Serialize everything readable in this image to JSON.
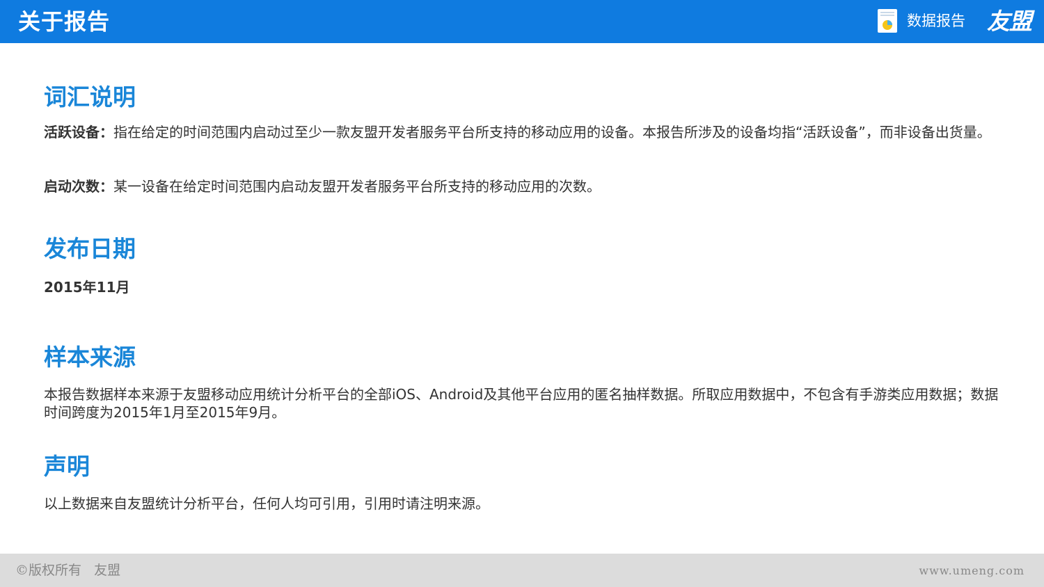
{
  "header": {
    "title": "关于报告",
    "report_label": "数据报告",
    "logo": "友盟",
    "icon": "report-document-icon",
    "bg_color": "#0f7be0"
  },
  "sections": {
    "glossary": {
      "title": "词汇说明",
      "items": [
        {
          "term": "活跃设备：",
          "text": "指在给定的时间范围内启动过至少一款友盟开发者服务平台所支持的移动应用的设备。本报告所涉及的设备均指“活跃设备”，而非设备出货量。"
        },
        {
          "term": "启动次数：",
          "text": "某一设备在给定时间范围内启动友盟开发者服务平台所支持的移动应用的次数。"
        }
      ]
    },
    "release": {
      "title": "发布日期",
      "date": "2015年11月"
    },
    "sample": {
      "title": "样本来源",
      "text": "本报告数据样本来源于友盟移动应用统计分析平台的全部iOS、Android及其他平台应用的匿名抽样数据。所取应用数据中，不包含有手游类应用数据；数据时间跨度为2015年1月至2015年9月。"
    },
    "disclaimer": {
      "title": "声明",
      "text": "以上数据来自友盟统计分析平台，任何人均可引用，引用时请注明来源。"
    }
  },
  "footer": {
    "copyright": "©版权所有   友盟",
    "url": "www.umeng.com"
  },
  "colors": {
    "accent": "#1a86d8",
    "header_bg": "#0f7be0",
    "footer_bg": "#dcdcdc"
  }
}
